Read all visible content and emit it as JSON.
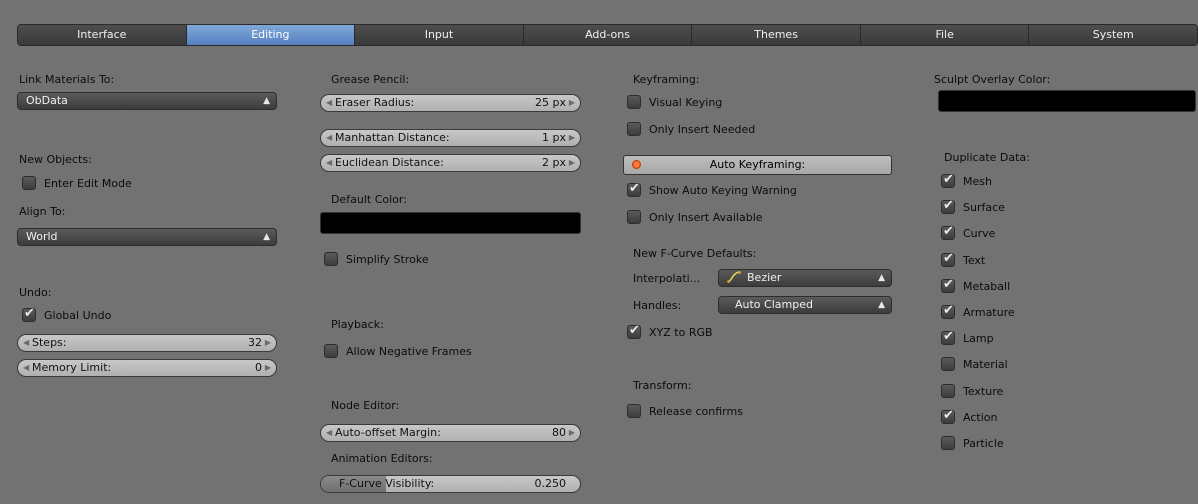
{
  "tabs": [
    "Interface",
    "Editing",
    "Input",
    "Add-ons",
    "Themes",
    "File",
    "System"
  ],
  "col1": {
    "link_materials_label": "Link Materials To:",
    "link_materials_value": "ObData",
    "new_objects_label": "New Objects:",
    "enter_edit_mode": "Enter Edit Mode",
    "align_to_label": "Align To:",
    "align_to_value": "World",
    "undo_label": "Undo:",
    "global_undo": "Global Undo",
    "steps_label": "Steps:",
    "steps_value": "32",
    "memory_limit_label": "Memory Limit:",
    "memory_limit_value": "0"
  },
  "col2": {
    "grease_pencil_label": "Grease Pencil:",
    "eraser_radius_label": "Eraser Radius:",
    "eraser_radius_value": "25 px",
    "manhattan_label": "Manhattan Distance:",
    "manhattan_value": "1 px",
    "euclidean_label": "Euclidean Distance:",
    "euclidean_value": "2 px",
    "default_color_label": "Default Color:",
    "simplify_stroke": "Simplify Stroke",
    "playback_label": "Playback:",
    "allow_negative_frames": "Allow Negative Frames",
    "node_editor_label": "Node Editor:",
    "auto_offset_label": "Auto-offset Margin:",
    "auto_offset_value": "80",
    "animation_editors_label": "Animation Editors:",
    "fcurve_visibility_label": "F-Curve Visibility:",
    "fcurve_visibility_value": "0.250"
  },
  "col3": {
    "keyframing_label": "Keyframing:",
    "visual_keying": "Visual Keying",
    "only_insert_needed": "Only Insert Needed",
    "auto_keyframing": "Auto Keyframing:",
    "show_auto_keying_warning": "Show Auto Keying Warning",
    "only_insert_available": "Only Insert Available",
    "new_fcurve_defaults_label": "New F-Curve Defaults:",
    "interpolation_label": "Interpolati...",
    "interpolation_value": "Bezier",
    "handles_label": "Handles:",
    "handles_value": "Auto Clamped",
    "xyz_to_rgb": "XYZ to RGB",
    "transform_label": "Transform:",
    "release_confirms": "Release confirms"
  },
  "col4": {
    "sculpt_overlay_label": "Sculpt Overlay Color:",
    "duplicate_data_label": "Duplicate Data:",
    "items": [
      {
        "label": "Mesh",
        "checked": true
      },
      {
        "label": "Surface",
        "checked": true
      },
      {
        "label": "Curve",
        "checked": true
      },
      {
        "label": "Text",
        "checked": true
      },
      {
        "label": "Metaball",
        "checked": true
      },
      {
        "label": "Armature",
        "checked": true
      },
      {
        "label": "Lamp",
        "checked": true
      },
      {
        "label": "Material",
        "checked": false
      },
      {
        "label": "Texture",
        "checked": false
      },
      {
        "label": "Action",
        "checked": true
      },
      {
        "label": "Particle",
        "checked": false
      }
    ]
  },
  "fcurve_visibility_fraction": 0.25
}
